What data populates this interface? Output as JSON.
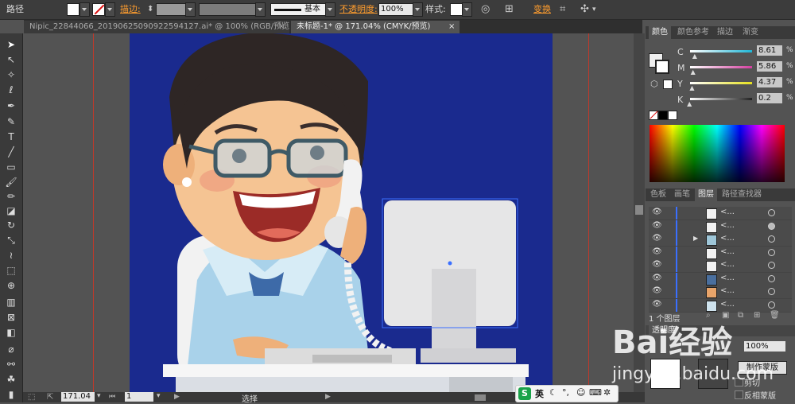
{
  "control_bar": {
    "object_type": "路径",
    "stroke_label": "描边:",
    "brush_label": "基本",
    "opacity_label": "不透明度:",
    "opacity_value": "100%",
    "style_label": "样式:",
    "transform_label": "变换"
  },
  "tabs": [
    {
      "label": "Nipic_22844066_20190625090922594127.ai* @ 100% (RGB/预览)",
      "active": false,
      "close": "×"
    },
    {
      "label": "未标题-1* @ 171.04% (CMYK/预览)",
      "active": true,
      "close": "×"
    }
  ],
  "status_bar": {
    "zoom": "171.04",
    "page": "1",
    "mode": "选择"
  },
  "color_panel": {
    "tabs": [
      "颜色",
      "颜色参考",
      "描边",
      "渐变"
    ],
    "sliders": [
      {
        "name": "C",
        "value": "8.61",
        "unit": "%",
        "color": "#1fb6d6",
        "pos": 0.086
      },
      {
        "name": "M",
        "value": "5.86",
        "unit": "%",
        "color": "#d43fa0",
        "pos": 0.059
      },
      {
        "name": "Y",
        "value": "4.37",
        "unit": "%",
        "color": "#e6e01f",
        "pos": 0.044
      },
      {
        "name": "K",
        "value": "0.2",
        "unit": "%",
        "color": "#222222",
        "pos": 0.002
      }
    ]
  },
  "layers_panel": {
    "tabs": [
      "色板",
      "画笔",
      "图层",
      "路径查找器"
    ],
    "layer_count": "1 个图层",
    "layers": [
      {
        "name": "<...",
        "thumb": "#f2f2f2"
      },
      {
        "name": "<...",
        "thumb": "#f2f2f2"
      },
      {
        "name": "<...",
        "thumb": "#9ec6d8"
      },
      {
        "name": "<...",
        "thumb": "#f2f2f2"
      },
      {
        "name": "<...",
        "thumb": "#f2f2f2"
      },
      {
        "name": "<...",
        "thumb": "#4a6f9e"
      },
      {
        "name": "<...",
        "thumb": "#e8a46a"
      },
      {
        "name": "<...",
        "thumb": "#cfe3ee"
      }
    ]
  },
  "transparency_panel": {
    "title": "透明度",
    "opacity": "100%",
    "make_mask_button": "制作蒙版",
    "clip_label": "剪切",
    "invert_label": "反相蒙版"
  },
  "ime_toolbar": {
    "lang": "英"
  },
  "watermark": {
    "text": "Bai经验",
    "url": "jingyan.baidu.com"
  },
  "colors": {
    "artboard": "#1a2a8e",
    "guide": "#c0392b",
    "accent_orange": "#ff9d2e"
  }
}
